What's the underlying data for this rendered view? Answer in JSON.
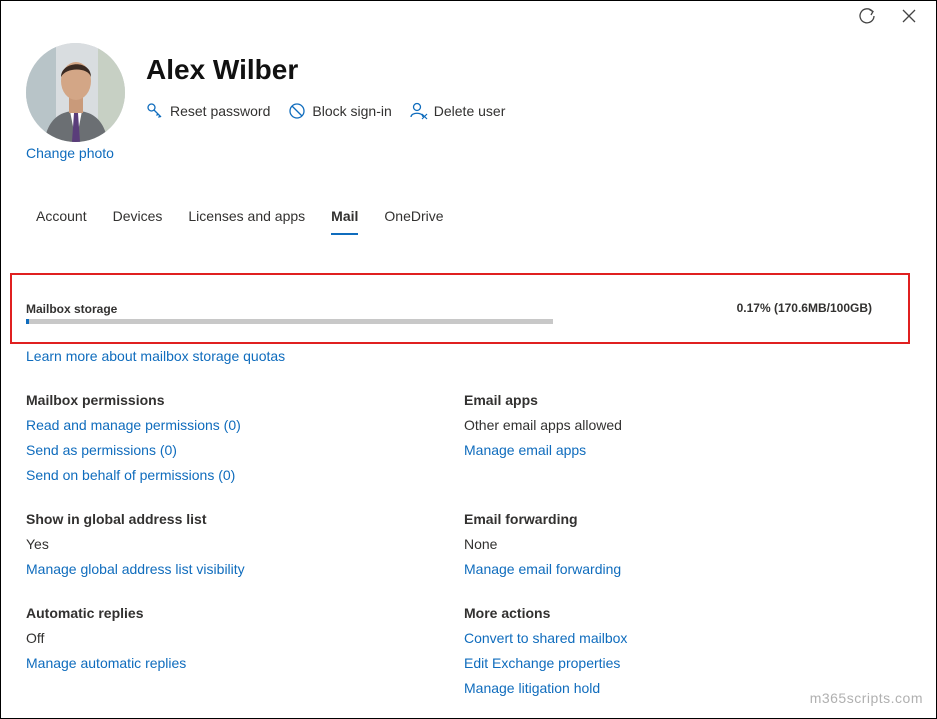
{
  "colors": {
    "link": "#0f6cbd",
    "accent": "#0f6cbd",
    "highlight_border": "#e02020"
  },
  "window": {
    "refresh_icon": "refresh-icon",
    "close_icon": "close-icon"
  },
  "user": {
    "name": "Alex Wilber",
    "change_photo": "Change photo",
    "actions": {
      "reset_password": "Reset password",
      "block_signin": "Block sign-in",
      "delete_user": "Delete user"
    }
  },
  "tabs": [
    {
      "label": "Account"
    },
    {
      "label": "Devices"
    },
    {
      "label": "Licenses and apps"
    },
    {
      "label": "Mail",
      "active": true
    },
    {
      "label": "OneDrive"
    }
  ],
  "storage": {
    "label": "Mailbox storage",
    "value_text": "0.17% (170.6MB/100GB)",
    "percent": 0.17,
    "learn_more": "Learn more about mailbox storage quotas"
  },
  "sections": {
    "mailbox_permissions": {
      "heading": "Mailbox permissions",
      "read_manage": "Read and manage permissions (0)",
      "send_as": "Send as permissions (0)",
      "send_on_behalf": "Send on behalf of permissions (0)"
    },
    "email_apps": {
      "heading": "Email apps",
      "value": "Other email apps allowed",
      "manage": "Manage email apps"
    },
    "global_address": {
      "heading": "Show in global address list",
      "value": "Yes",
      "manage": "Manage global address list visibility"
    },
    "email_forwarding": {
      "heading": "Email forwarding",
      "value": "None",
      "manage": "Manage email forwarding"
    },
    "automatic_replies": {
      "heading": "Automatic replies",
      "value": "Off",
      "manage": "Manage automatic replies"
    },
    "more_actions": {
      "heading": "More actions",
      "convert": "Convert to shared mailbox",
      "edit_exchange": "Edit Exchange properties",
      "litigation": "Manage litigation hold"
    }
  },
  "watermark": "m365scripts.com"
}
